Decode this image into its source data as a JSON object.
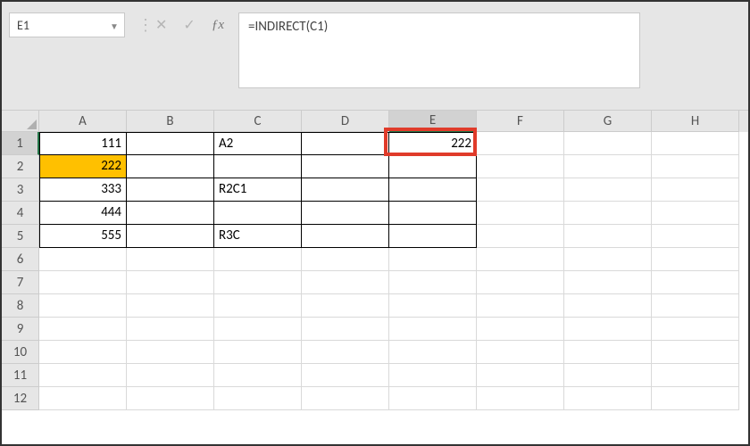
{
  "nameBox": {
    "value": "E1"
  },
  "formulaBar": {
    "value": "=INDIRECT(C1)"
  },
  "columns": [
    "A",
    "B",
    "C",
    "D",
    "E",
    "F",
    "G",
    "H"
  ],
  "selectedColumn": "E",
  "rowCount": 12,
  "selectedRow": 1,
  "cells": {
    "A1": {
      "value": "111",
      "type": "num"
    },
    "A2": {
      "value": "222",
      "type": "num",
      "fill": "yellow"
    },
    "A3": {
      "value": "333",
      "type": "num"
    },
    "A4": {
      "value": "444",
      "type": "num"
    },
    "A5": {
      "value": "555",
      "type": "num"
    },
    "C1": {
      "value": "A2",
      "type": "txt"
    },
    "C3": {
      "value": "R2C1",
      "type": "txt"
    },
    "C5": {
      "value": "R3C",
      "type": "txt"
    },
    "E1": {
      "value": "222",
      "type": "num"
    }
  },
  "borderedRegion": {
    "cols": [
      "A",
      "B",
      "C",
      "D",
      "E"
    ],
    "rows": [
      1,
      2,
      3,
      4,
      5
    ]
  },
  "activeCell": "E1",
  "highlightBox": {
    "cell": "E1"
  }
}
